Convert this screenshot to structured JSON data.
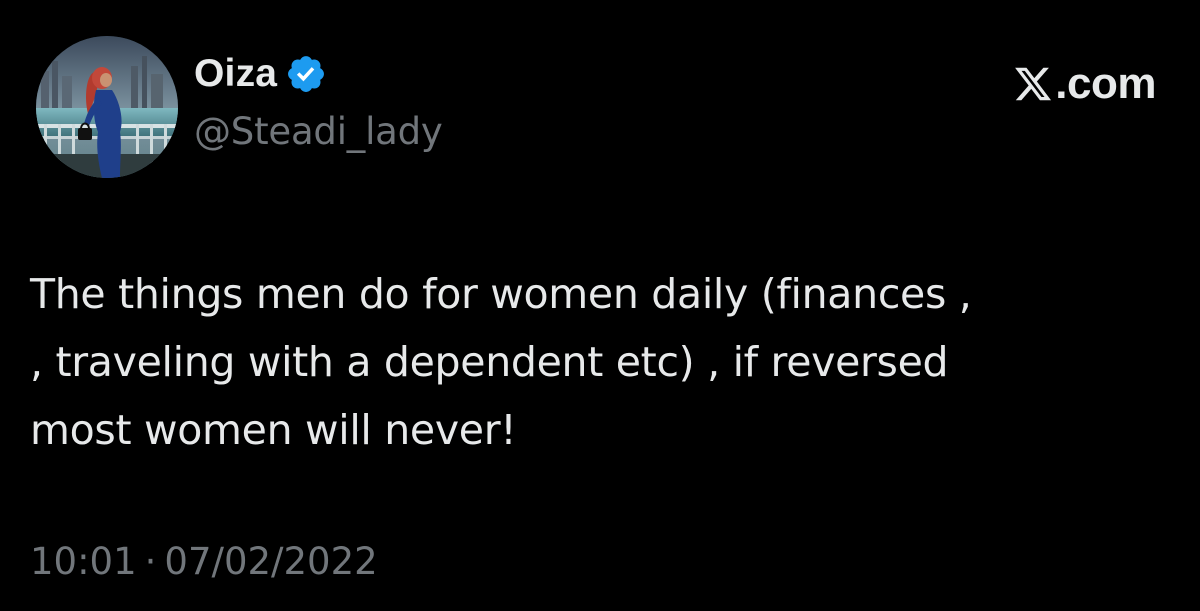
{
  "author": {
    "display_name": "Oiza",
    "handle": "@Steadi_lady",
    "verified_icon": "verified-badge-icon",
    "avatar_icon": "profile-photo"
  },
  "brand": {
    "icon": "x-logo-icon",
    "text": ".com"
  },
  "tweet": {
    "text": "The things men do for women daily (finances ,\n, traveling with a dependent etc) , if reversed\nmost women will never!"
  },
  "meta": {
    "time": "10:01",
    "separator": "·",
    "date": "07/02/2022"
  },
  "colors": {
    "background": "#000000",
    "primary_text": "#e7e9ea",
    "secondary_text": "#71767b",
    "verified_blue": "#1d9bf0"
  }
}
